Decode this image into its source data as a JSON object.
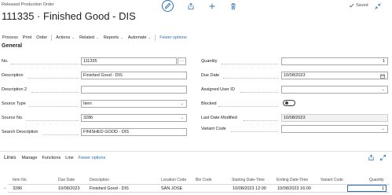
{
  "header": {
    "breadcrumb": "Released Production Order",
    "title": "111335 · Finished Good - DIS",
    "saved_label": "Saved"
  },
  "actionbar": {
    "process": "Process",
    "print": "Print",
    "order": "Order",
    "actions": "Actions",
    "related": "Related",
    "reports": "Reports",
    "automate": "Automate",
    "fewer": "Fewer options"
  },
  "general": {
    "section_title": "General",
    "no_label": "No.",
    "no_value": "111335",
    "dots": "···",
    "description_label": "Description",
    "description_value": "Finished Good - DIS",
    "description2_label": "Description 2",
    "description2_value": "",
    "source_type_label": "Source Type",
    "source_type_value": "Item",
    "source_no_label": "Source No.",
    "source_no_value": "3286",
    "search_description_label": "Search Description",
    "search_description_value": "FINISHED GOOD - DIS",
    "quantity_label": "Quantity",
    "quantity_value": "1",
    "due_date_label": "Due Date",
    "due_date_value": "10/08/2023",
    "assigned_user_label": "Assigned User ID",
    "assigned_user_value": "",
    "blocked_label": "Blocked",
    "blocked_on": false,
    "last_modified_label": "Last Date Modified",
    "last_modified_value": "10/08/2023",
    "variant_code_label": "Variant Code",
    "variant_code_value": ""
  },
  "lines": {
    "title": "Lines",
    "manage": "Manage",
    "functions": "Functions",
    "line": "Line",
    "fewer": "Fewer options",
    "columns": {
      "item_no": "Item No.",
      "due_date": "Due Date",
      "description": "Description",
      "location_code": "Location Code",
      "bin_code": "Bin Code",
      "starting": "Starting Date-Time",
      "ending": "Ending Date-Time",
      "variant": "Variant Code",
      "quantity": "Quantity"
    },
    "rows": [
      {
        "item_no": "3286",
        "due_date": "10/08/2023",
        "description": "Finished Good - DIS",
        "location_code": "SAN JOSE",
        "bin_code": "",
        "starting": "10/08/2023 12:00",
        "ending": "10/08/2023 16:00",
        "variant": "",
        "quantity": "1"
      }
    ]
  },
  "colors": {
    "accent": "#2b6fb5",
    "text": "#212121",
    "muted": "#505050"
  }
}
